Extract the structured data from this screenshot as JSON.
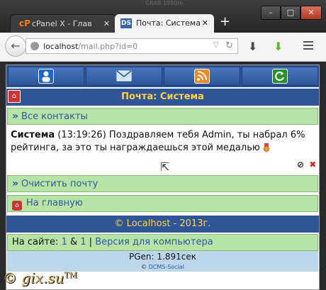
{
  "window": {
    "title": "GRAB 1990m",
    "min": "–",
    "max": "□",
    "close": "✕"
  },
  "tabs": [
    {
      "label": "cPanel X - Глав",
      "favicon": "cP",
      "close": "✕"
    },
    {
      "label": "Почта: Система",
      "favicon": "DS",
      "close": "✕"
    }
  ],
  "new_tab": "+",
  "toolbar": {
    "url_host": "localhost",
    "url_path": "/mail.php?id=0",
    "back": "←"
  },
  "nav": [
    "user-icon",
    "mail-icon",
    "rss-icon",
    "refresh-icon"
  ],
  "header": {
    "title": "Почта: Система"
  },
  "all_contacts": {
    "arrow": "»",
    "label": "Все контакты"
  },
  "message": {
    "author": "Система",
    "time": "(13:19:26)",
    "text": "Поздравляем тебя Admin, ты набрал 6% рейтинга, за это ты награждаешься этой медалью"
  },
  "actions": {
    "block": "⊘",
    "delete": "✖"
  },
  "clear_mail": {
    "arrow": "»",
    "label": "Очистить почту"
  },
  "home_link": {
    "label": "На главную"
  },
  "footer": {
    "copyright": "© Localhost - 2013г."
  },
  "online": {
    "prefix": "На сайте:",
    "count1": "1",
    "sep": "&",
    "count2": "1",
    "divider": "|",
    "version": "Версия для компьютера"
  },
  "pgen": "PGen: 1.891сек",
  "copyright_line": {
    "symbol": "©",
    "name": "DCMS-Social"
  },
  "watermark": {
    "text": "© gix.su",
    "tm": "TM"
  },
  "colors": {
    "nav_bg": "#2f5597",
    "green_bar": "#b9e3a6",
    "title_yellow": "#ffd24a",
    "pgen_bg": "#bcd7ec"
  }
}
